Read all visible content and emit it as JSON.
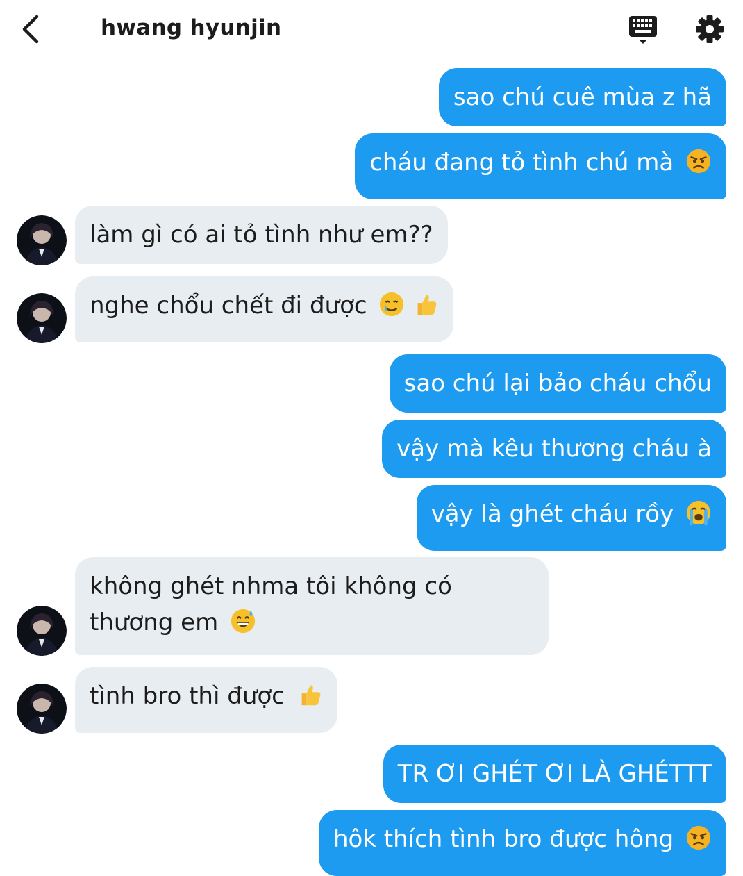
{
  "header": {
    "title": "hwang hyunjin"
  },
  "messages": [
    {
      "side": "sent",
      "text": "sao chú cuê mùa z hã"
    },
    {
      "side": "sent",
      "text": "cháu đang tỏ tình chú mà",
      "emoji": "angry-face"
    },
    {
      "side": "received",
      "text": "làm gì có ai tỏ tình như em??"
    },
    {
      "side": "received",
      "text": "nghe chổu chết đi được",
      "emoji": "smiling-face-with-tear + thumbs-up"
    },
    {
      "side": "sent",
      "text": "sao chú lại bảo cháu chổu"
    },
    {
      "side": "sent",
      "text": "vậy mà kêu thương cháu à"
    },
    {
      "side": "sent",
      "text": "vậy là ghét cháu rồy",
      "emoji": "loudly-crying-face"
    },
    {
      "side": "received",
      "text_line1": "không ghét nhma tôi không có",
      "text_line2": "thương em",
      "emoji": "grinning-face-with-sweat"
    },
    {
      "side": "received",
      "text": "tình bro thì được",
      "emoji": "thumbs-up"
    },
    {
      "side": "sent",
      "text": "TR ƠI GHÉT ƠI LÀ GHÉTTT"
    },
    {
      "side": "sent",
      "text": "hôk thích tình bro được hông",
      "emoji": "angry-face"
    }
  ],
  "colors": {
    "sent_bubble": "#1d9bf0",
    "received_bubble": "#e8edf1",
    "sent_text": "#ffffff",
    "received_text": "#1c1c1c"
  }
}
